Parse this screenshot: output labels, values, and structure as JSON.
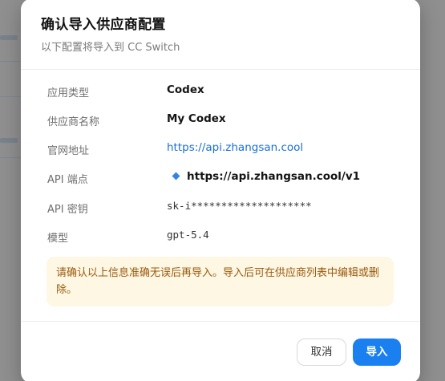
{
  "dialog": {
    "title": "确认导入供应商配置",
    "subtitle": "以下配置将导入到 CC Switch"
  },
  "fields": {
    "app_type": {
      "label": "应用类型",
      "value": "Codex"
    },
    "provider_name": {
      "label": "供应商名称",
      "value": "My Codex"
    },
    "website": {
      "label": "官网地址",
      "value": "https://api.zhangsan.cool"
    },
    "api_endpoint": {
      "label": "API 端点",
      "value": "https://api.zhangsan.cool/v1"
    },
    "api_key": {
      "label": "API 密钥",
      "value": "sk-i********************"
    },
    "model": {
      "label": "模型",
      "value": "gpt-5.4"
    }
  },
  "warning": {
    "text": "请确认以上信息准确无误后再导入。导入后可在供应商列表中编辑或删除。"
  },
  "buttons": {
    "cancel_label": "取消",
    "import_label": "导入"
  },
  "colors": {
    "primary": "#1a80f0",
    "link": "#1a6fd8",
    "warning_bg": "#fdf7e3",
    "warning_text": "#9a5a0e"
  }
}
